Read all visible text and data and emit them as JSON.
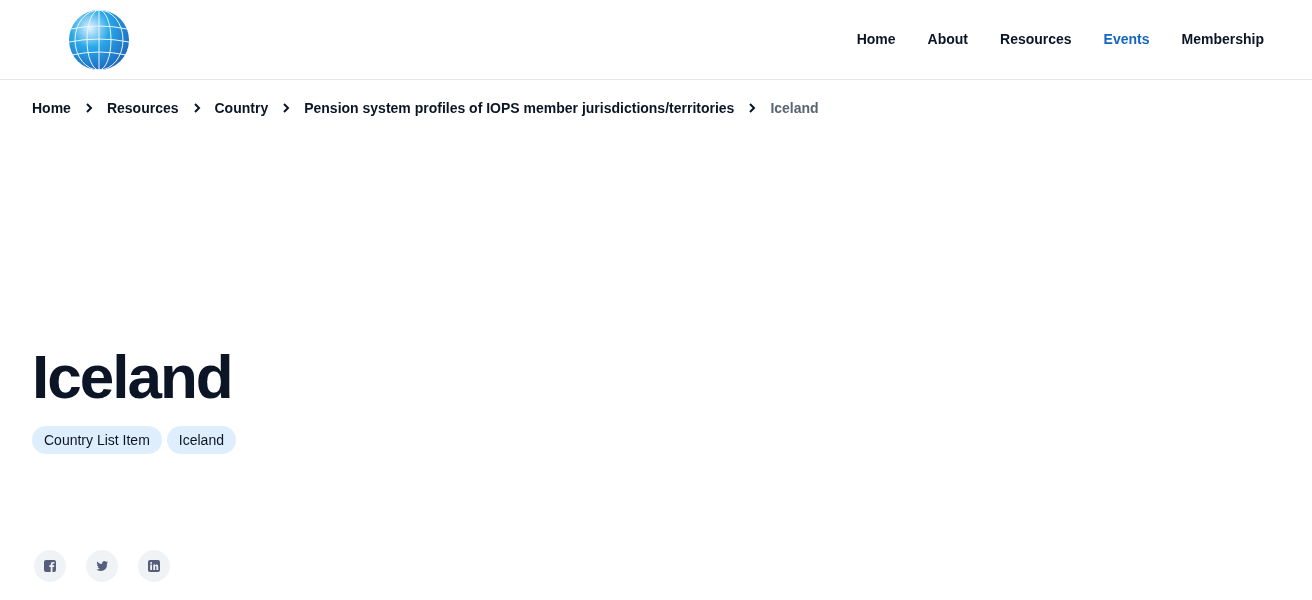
{
  "nav": [
    {
      "label": "Home",
      "selected": false
    },
    {
      "label": "About",
      "selected": false
    },
    {
      "label": "Resources",
      "selected": false
    },
    {
      "label": "Events",
      "selected": true
    },
    {
      "label": "Membership",
      "selected": false
    }
  ],
  "breadcrumb": [
    {
      "label": "Home",
      "current": false
    },
    {
      "label": "Resources",
      "current": false
    },
    {
      "label": "Country",
      "current": false
    },
    {
      "label": "Pension system profiles of IOPS member jurisdictions/territories",
      "current": false
    },
    {
      "label": "Iceland",
      "current": true
    }
  ],
  "title": "Iceland",
  "tags": [
    "Country List Item",
    "Iceland"
  ],
  "share": [
    {
      "kind": "facebook"
    },
    {
      "kind": "twitter"
    },
    {
      "kind": "linkedin"
    }
  ]
}
